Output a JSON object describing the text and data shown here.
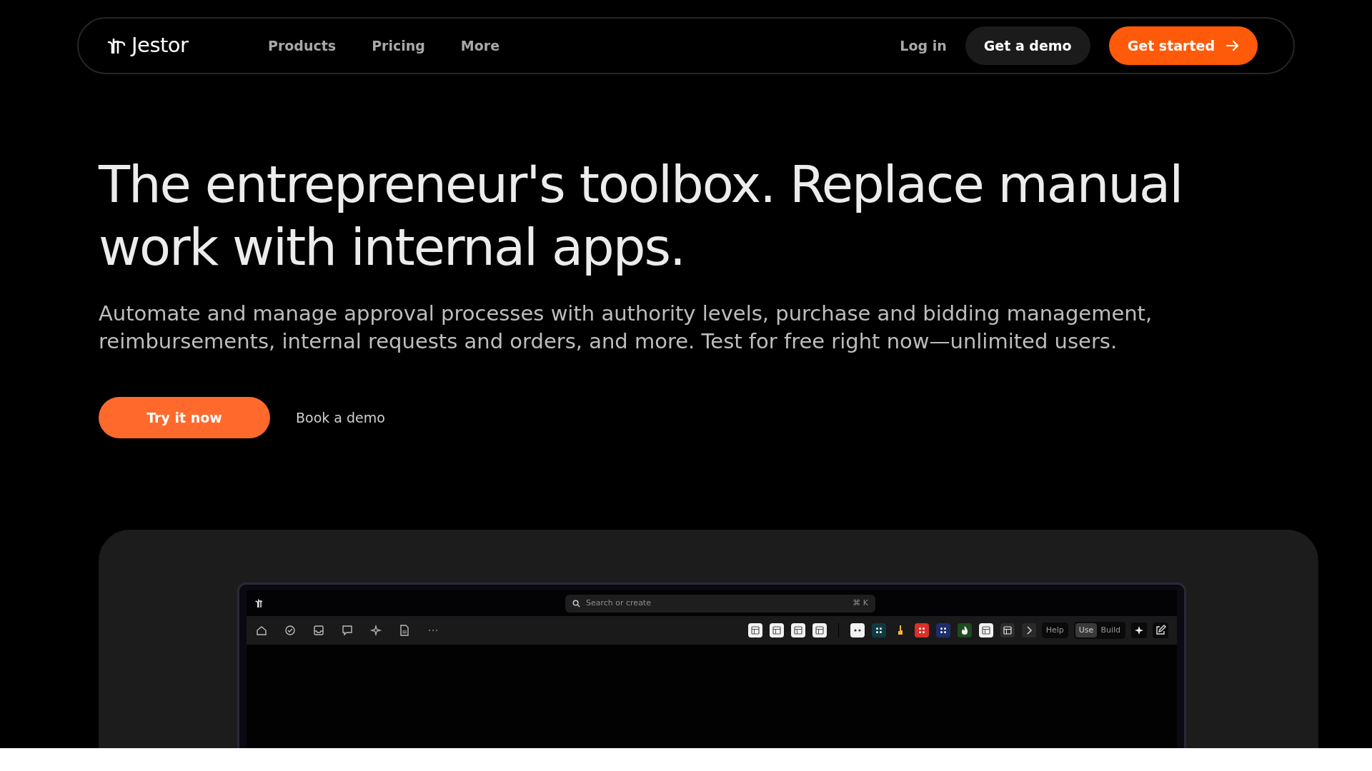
{
  "navbar": {
    "brand": "Jestor",
    "links": [
      {
        "label": "Products"
      },
      {
        "label": "Pricing"
      },
      {
        "label": "More"
      }
    ],
    "login": "Log in",
    "demo_button": "Get a demo",
    "start_button": "Get started"
  },
  "hero": {
    "title": "The entrepreneur's toolbox. Replace manual work with internal apps.",
    "subtitle": "Automate and manage approval processes with authority levels, purchase and bidding management, reimbursements, internal requests and orders, and more. Test for free right now—unlimited users.",
    "primary_button": "Try it now",
    "secondary_link": "Book a demo"
  },
  "app_preview": {
    "search": {
      "placeholder": "Search or create",
      "shortcut": "⌘ K"
    },
    "tiles": [
      {
        "kind": "table",
        "color": "#f2f2f2"
      },
      {
        "kind": "table",
        "color": "#f2f2f2"
      },
      {
        "kind": "table",
        "color": "#f2f2f2"
      },
      {
        "kind": "table",
        "color": "#f2f2f2"
      },
      {
        "kind": "divider"
      },
      {
        "kind": "eyes",
        "color": "#f2f2f2"
      },
      {
        "kind": "dots",
        "color": "#0f3a40"
      },
      {
        "kind": "hand"
      },
      {
        "kind": "dots",
        "color": "#d9302a"
      },
      {
        "kind": "dots",
        "color": "#1e2d6b"
      },
      {
        "kind": "flame",
        "color": "#1f4a22"
      },
      {
        "kind": "table",
        "color": "#f2f2f2"
      },
      {
        "kind": "table",
        "color": "#2c2c2c"
      },
      {
        "kind": "chevron",
        "color": "#2a2a2a"
      }
    ],
    "help": "Help",
    "modes": [
      {
        "label": "Use",
        "selected": true
      },
      {
        "label": "Build",
        "selected": false
      }
    ]
  }
}
